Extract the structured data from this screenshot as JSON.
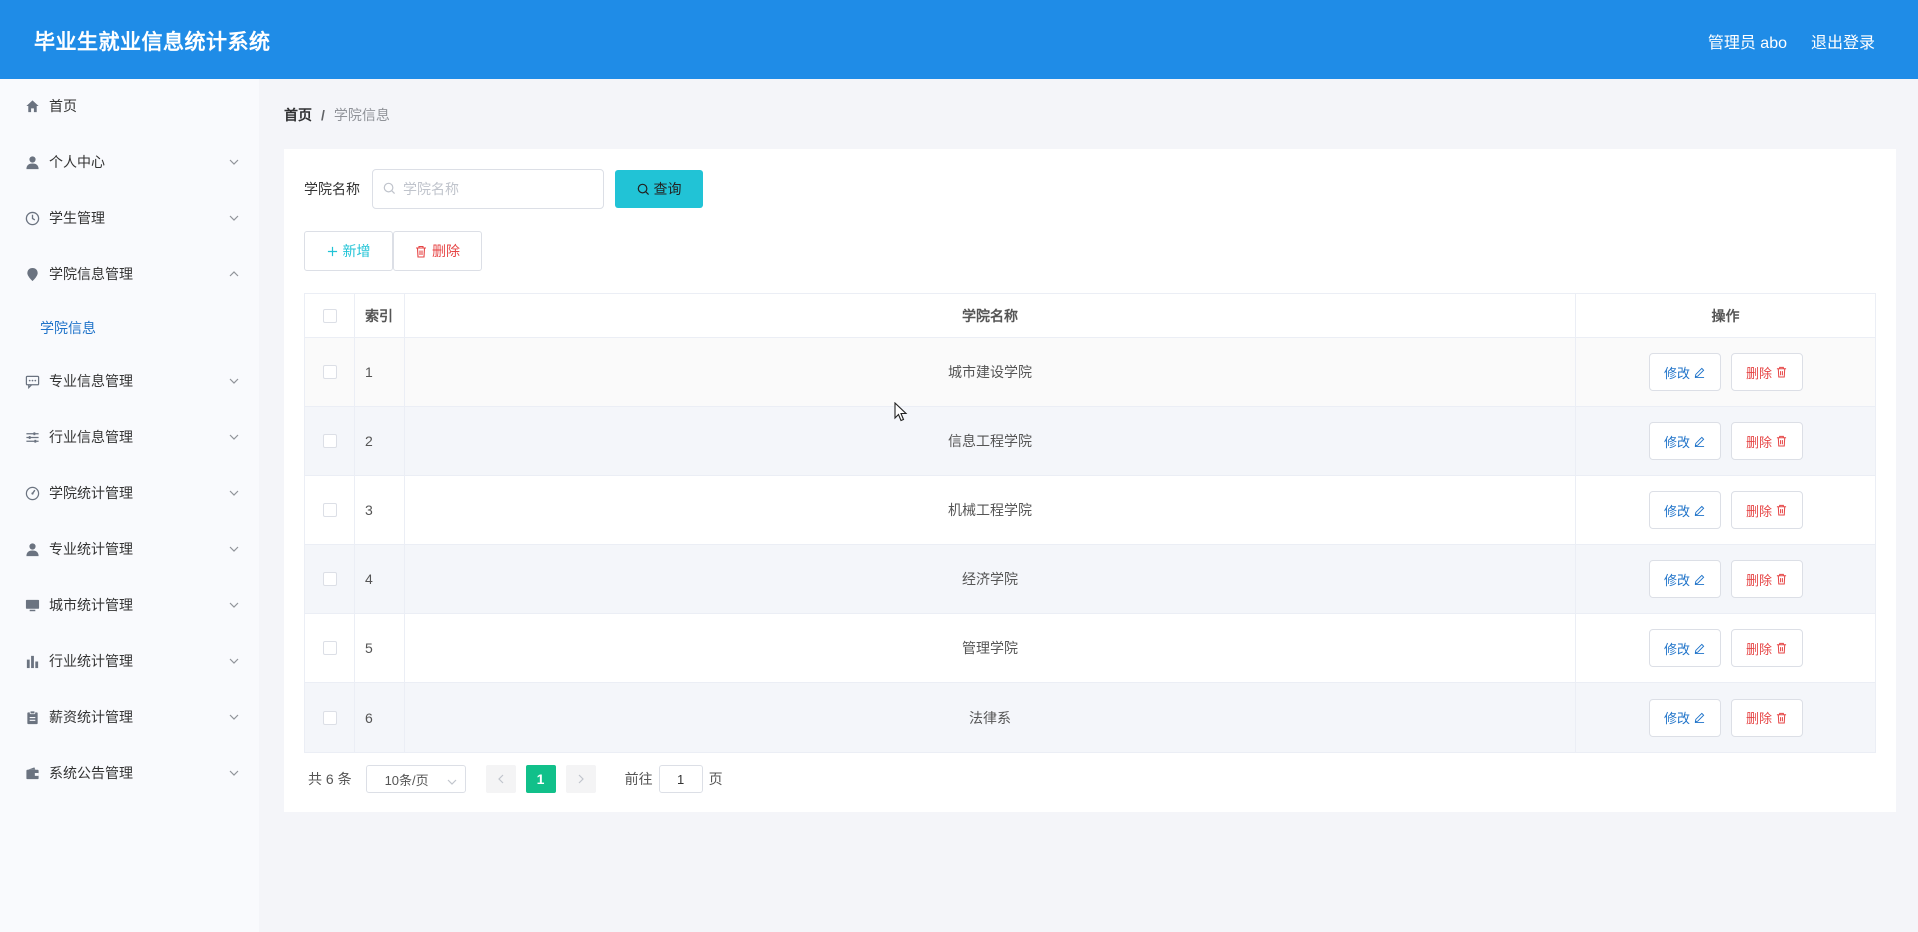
{
  "header": {
    "title": "毕业生就业信息统计系统",
    "user": "管理员 abo",
    "logout": "退出登录"
  },
  "sidebar": {
    "items": [
      {
        "label": "首页",
        "icon": "home-icon"
      },
      {
        "label": "个人中心",
        "icon": "user-icon"
      },
      {
        "label": "学生管理",
        "icon": "clock-icon"
      },
      {
        "label": "学院信息管理",
        "icon": "location-icon"
      },
      {
        "label": "学院信息",
        "icon": ""
      },
      {
        "label": "专业信息管理",
        "icon": "chat-icon"
      },
      {
        "label": "行业信息管理",
        "icon": "sliders-icon"
      },
      {
        "label": "学院统计管理",
        "icon": "gauge-icon"
      },
      {
        "label": "专业统计管理",
        "icon": "user-icon"
      },
      {
        "label": "城市统计管理",
        "icon": "monitor-icon"
      },
      {
        "label": "行业统计管理",
        "icon": "bar-chart-icon"
      },
      {
        "label": "薪资统计管理",
        "icon": "clipboard-icon"
      },
      {
        "label": "系统公告管理",
        "icon": "wallet-icon"
      }
    ]
  },
  "breadcrumb": {
    "home": "首页",
    "separator": "/",
    "current": "学院信息"
  },
  "search": {
    "label": "学院名称",
    "placeholder": "学院名称",
    "value": "",
    "button": "查询"
  },
  "actions": {
    "add": "新增",
    "delete": "删除"
  },
  "table": {
    "headers": {
      "index": "索引",
      "name": "学院名称",
      "op": "操作"
    },
    "rows": [
      {
        "index": "1",
        "name": "城市建设学院"
      },
      {
        "index": "2",
        "name": "信息工程学院"
      },
      {
        "index": "3",
        "name": "机械工程学院"
      },
      {
        "index": "4",
        "name": "经济学院"
      },
      {
        "index": "5",
        "name": "管理学院"
      },
      {
        "index": "6",
        "name": "法律系"
      }
    ],
    "edit_label": "修改",
    "delete_label": "删除"
  },
  "pagination": {
    "total": "共 6 条",
    "page_size": "10条/页",
    "current": "1",
    "goto_label": "前往",
    "goto_value": "1",
    "page_unit": "页"
  },
  "colors": {
    "header_bg": "#1f8ce7",
    "accent": "#21c3d6",
    "danger": "#e64545",
    "page_active": "#11c08a"
  }
}
